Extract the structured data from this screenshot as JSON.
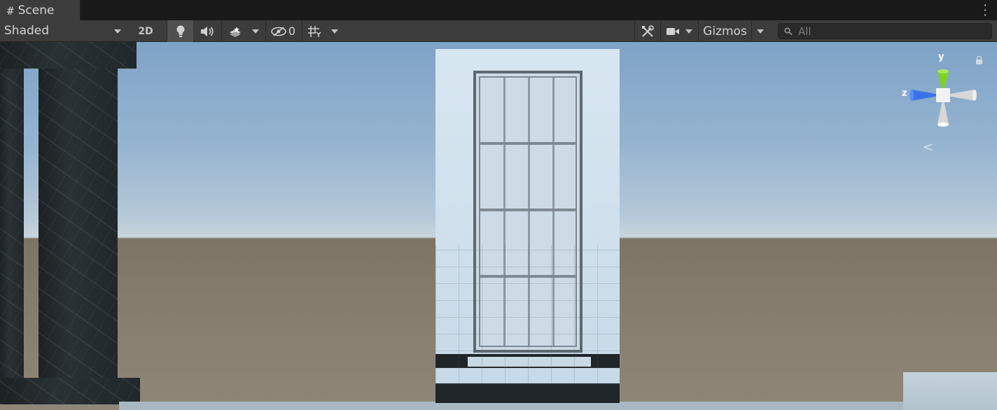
{
  "tab": {
    "icon": "grid-hash-icon",
    "title": "Scene"
  },
  "toolbar": {
    "draw_mode": "Shaded",
    "mode_2d": "2D",
    "hidden_count": "0",
    "gizmos": "Gizmos",
    "search_placeholder": "All"
  },
  "gizmo": {
    "y_label": "y",
    "z_label": "z",
    "x_color": "#d8d8d8",
    "y_color": "#7ed321",
    "z_color": "#3a73e8"
  },
  "icons": [
    "grid-hash-icon",
    "kebab-menu-icon",
    "dropdown-arrow-icon",
    "lightbulb-icon",
    "audio-icon",
    "effects-icon",
    "visibility-icon",
    "grid-snap-icon",
    "tools-icon",
    "camera-icon",
    "search-icon",
    "lock-icon"
  ]
}
